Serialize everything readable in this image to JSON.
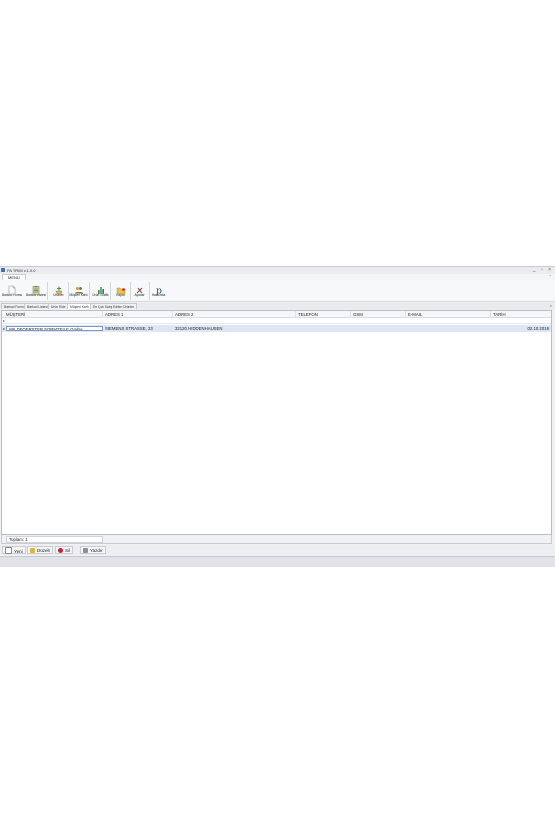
{
  "window": {
    "title": "PA TRIM v.1.0.0",
    "controls": "_ ▫ ×"
  },
  "menu": {
    "tab": "MENÜ",
    "pin": "⌃"
  },
  "ribbon": {
    "buttons": [
      {
        "label": "Barkod Formu",
        "icon": "document-icon"
      },
      {
        "label": "Barkod Listesi",
        "icon": "clipboard-list-icon"
      },
      {
        "label": "Ürünler",
        "icon": "product-add-icon"
      },
      {
        "label": "Müşteri Kartı",
        "icon": "customers-icon"
      },
      {
        "label": "Ürün Grafik",
        "icon": "bar-chart-icon"
      },
      {
        "label": "Kapat",
        "icon": "folder-close-icon"
      },
      {
        "label": "Ayarlar",
        "icon": "tools-icon"
      },
      {
        "label": "Hakkında",
        "icon": "about-p-icon"
      }
    ]
  },
  "doc_tabs": {
    "tabs": [
      {
        "label": "Barkod Formu"
      },
      {
        "label": "Barkod Listesi"
      },
      {
        "label": "Ürün Ekle"
      },
      {
        "label": "Müşteri Kartı"
      },
      {
        "label": "En Çok Satış Edilen Ürünler"
      }
    ],
    "close": "×"
  },
  "grid": {
    "columns": [
      "MÜŞTERİ",
      "ADRES 1",
      "ADRES 2",
      "TELEFON",
      "GSM",
      "E-MAIL",
      "TARİH"
    ],
    "filter_indicator": "▸",
    "row_indicator": "▸",
    "rows": [
      [
        "WILDFOERSTER FORMTEILE GmbH",
        "SIEMENS STRASSE, 23",
        "32120 HIDDENHAUSEN",
        "",
        "",
        "",
        "02.10.2019"
      ]
    ]
  },
  "footer": {
    "total_label": "Toplam: 1"
  },
  "actions": {
    "new_label": "Yeni",
    "edit_label": "Düzelt",
    "delete_label": "Sil",
    "print_label": "Yazdır"
  },
  "colors": {
    "selected_row": "#dde6f5",
    "accent": "#3f6fb5",
    "delete": "#c0282d"
  }
}
